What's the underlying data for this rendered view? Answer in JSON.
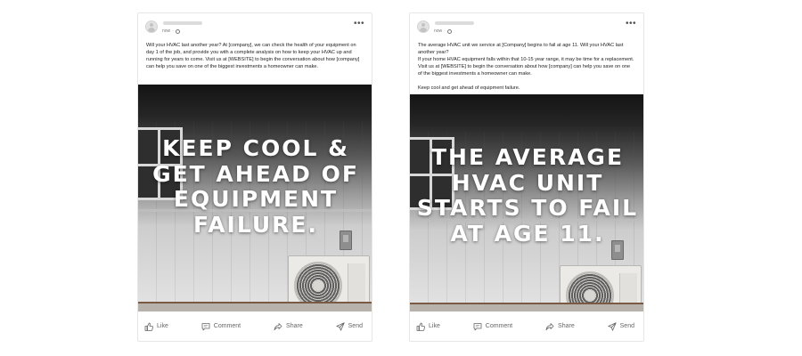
{
  "posts": [
    {
      "meta": "now",
      "caption": [
        "Will your HVAC last another year? At [company], we can check the health of your equipment on day 1 of the job, and provide you with a complete analysis on how to keep your HVAC up and running for years to come. Visit us at [WEBSITE] to begin the conversation about how [company] can help you save on one of the biggest investments a homeowner can make."
      ],
      "overlay_text": "KEEP COOL & GET AHEAD OF EQUIPMENT FAILURE.",
      "actions": {
        "like": "Like",
        "comment": "Comment",
        "share": "Share",
        "send": "Send"
      }
    },
    {
      "meta": "now",
      "caption": [
        "The average HVAC unit we service at [Company] begins to fail at age 11. Will your HVAC last another year?\nIf your home HVAC equipment falls within that 10-15 year range, it may be time for a replacement. Visit us at [WEBSITE] to begin the conversation about how [company] can help you save on one of the biggest investments a homeowner can make.",
        "Keep cool and get ahead of equipment failure."
      ],
      "overlay_text": "THE AVERAGE HVAC UNIT STARTS TO FAIL AT AGE 11.",
      "actions": {
        "like": "Like",
        "comment": "Comment",
        "share": "Share",
        "send": "Send"
      }
    }
  ]
}
